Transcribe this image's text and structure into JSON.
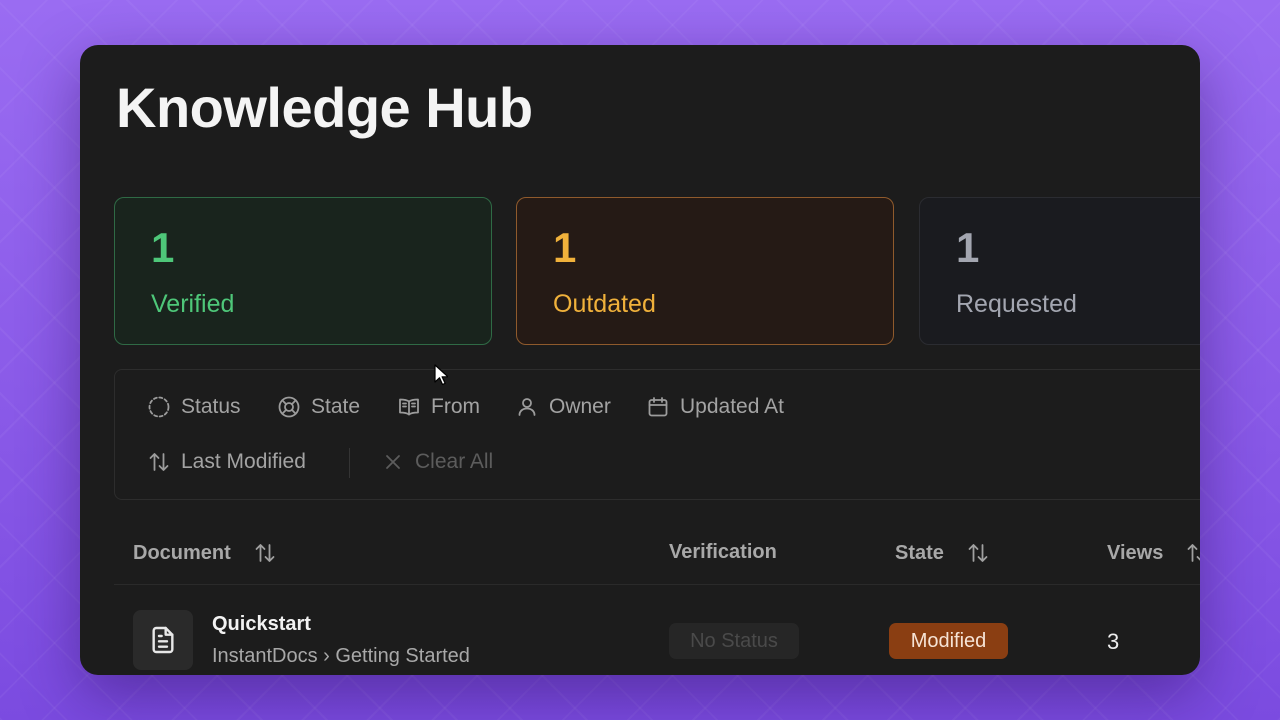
{
  "page": {
    "title": "Knowledge Hub"
  },
  "stats": [
    {
      "count": "1",
      "label": "Verified",
      "color": "#4ec779"
    },
    {
      "count": "1",
      "label": "Outdated",
      "color": "#f0b13b"
    },
    {
      "count": "1",
      "label": "Requested",
      "color": "#a3a6b0"
    }
  ],
  "filters": {
    "status": {
      "label": "Status",
      "icon": "dashed-circle-icon"
    },
    "state": {
      "label": "State",
      "icon": "lifebuoy-icon"
    },
    "from": {
      "label": "From",
      "icon": "book-open-icon"
    },
    "owner": {
      "label": "Owner",
      "icon": "user-icon"
    },
    "updated_at": {
      "label": "Updated At",
      "icon": "calendar-icon"
    },
    "last_modified": {
      "label": "Last Modified",
      "icon": "sort-arrows-icon"
    },
    "clear_all": {
      "label": "Clear All",
      "icon": "close-icon"
    }
  },
  "table": {
    "columns": {
      "document": "Document",
      "verification": "Verification",
      "state": "State",
      "views": "Views"
    },
    "rows": [
      {
        "title": "Quickstart",
        "path": "InstantDocs › Getting Started",
        "verification": "No Status",
        "state": "Modified",
        "views": "3"
      }
    ]
  }
}
